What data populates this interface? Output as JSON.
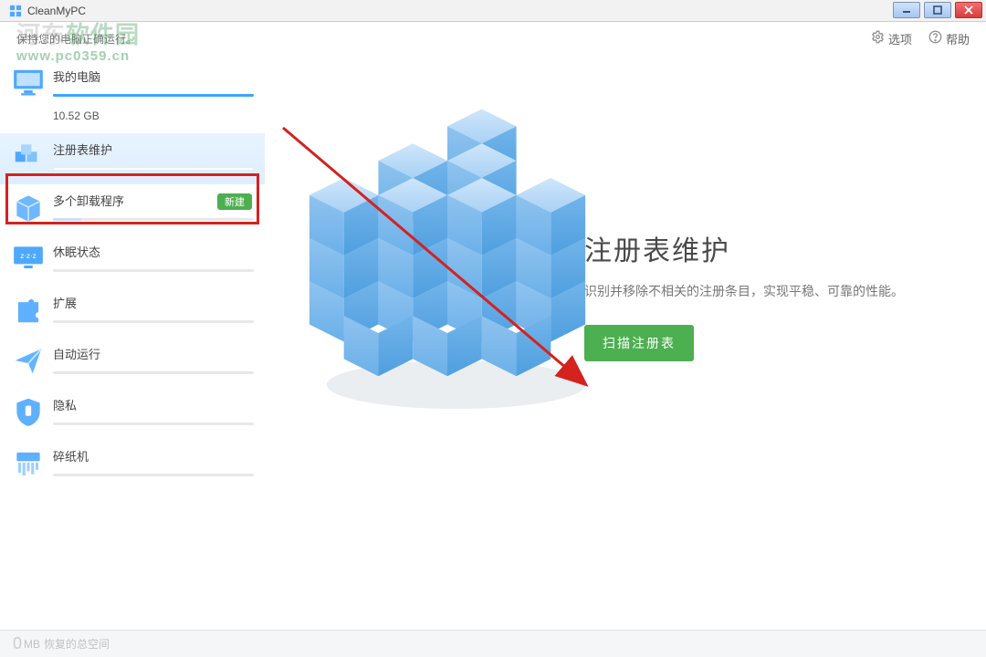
{
  "titlebar": {
    "title": "CleanMyPC"
  },
  "watermark": {
    "line1a": "河东",
    "line1b": "软件园",
    "url": "www.pc0359.cn"
  },
  "header": {
    "tagline": "保持您的电脑正确运行。",
    "options": "选项",
    "help": "帮助"
  },
  "sidebar": {
    "items": [
      {
        "label": "我的电脑",
        "sub": "10.52 GB"
      },
      {
        "label": "注册表维护"
      },
      {
        "label": "多个卸载程序",
        "badge": "新建"
      },
      {
        "label": "休眠状态"
      },
      {
        "label": "扩展"
      },
      {
        "label": "自动运行"
      },
      {
        "label": "隐私"
      },
      {
        "label": "碎纸机"
      }
    ]
  },
  "main": {
    "title": "注册表维护",
    "desc": "识别并移除不相关的注册条目，实现平稳、可靠的性能。",
    "scan_button": "扫描注册表"
  },
  "footer": {
    "value": "0",
    "unit": "MB",
    "label": "恢复的总空间"
  }
}
